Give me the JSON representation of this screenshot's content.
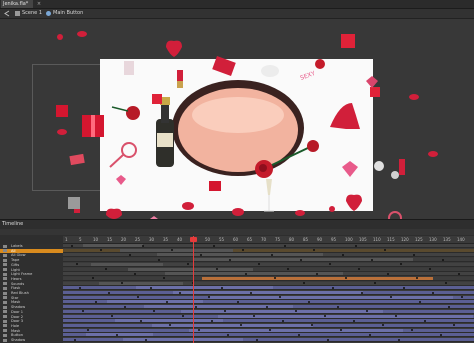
{
  "tabs": [
    {
      "label": "Jenika.fla*",
      "active": true
    }
  ],
  "tab_close": "×",
  "breadcrumb": {
    "scene": "Scene 1",
    "symbol": "Main Button"
  },
  "timeline": {
    "title": "Timeline",
    "ruler_ticks": [
      "1",
      "5",
      "10",
      "15",
      "20",
      "25",
      "30",
      "35",
      "40",
      "45",
      "50",
      "55",
      "60",
      "65",
      "70",
      "75",
      "80",
      "85",
      "90",
      "95",
      "100",
      "105",
      "110",
      "115",
      "120",
      "125",
      "130",
      "135",
      "140"
    ],
    "layers": [
      {
        "name": "Labels",
        "selected": false
      },
      {
        "name": "All",
        "selected": true
      },
      {
        "name": "All Glow",
        "selected": false
      },
      {
        "name": "Tape",
        "selected": false
      },
      {
        "name": "Gifts",
        "selected": false
      },
      {
        "name": "Light",
        "selected": false
      },
      {
        "name": "Light Frame",
        "selected": false
      },
      {
        "name": "Hears",
        "selected": false
      },
      {
        "name": "Sounds",
        "selected": false
      },
      {
        "name": "Flask",
        "selected": false
      },
      {
        "name": "Red Blush",
        "selected": false
      },
      {
        "name": "Star",
        "selected": false
      },
      {
        "name": "Mask",
        "selected": false
      },
      {
        "name": "Shadow",
        "selected": false
      },
      {
        "name": "Door 1",
        "selected": false
      },
      {
        "name": "Door 2",
        "selected": false
      },
      {
        "name": "Door 3",
        "selected": false
      },
      {
        "name": "Hole",
        "selected": false
      },
      {
        "name": "Mask",
        "selected": false
      },
      {
        "name": "Button",
        "selected": false
      },
      {
        "name": "Shadow",
        "selected": false
      }
    ]
  },
  "colors": {
    "selected_layer": "#d98b1e",
    "playhead": "#e53b3b",
    "mask_rows": "#5b5f93",
    "stage": "#fafafa"
  }
}
